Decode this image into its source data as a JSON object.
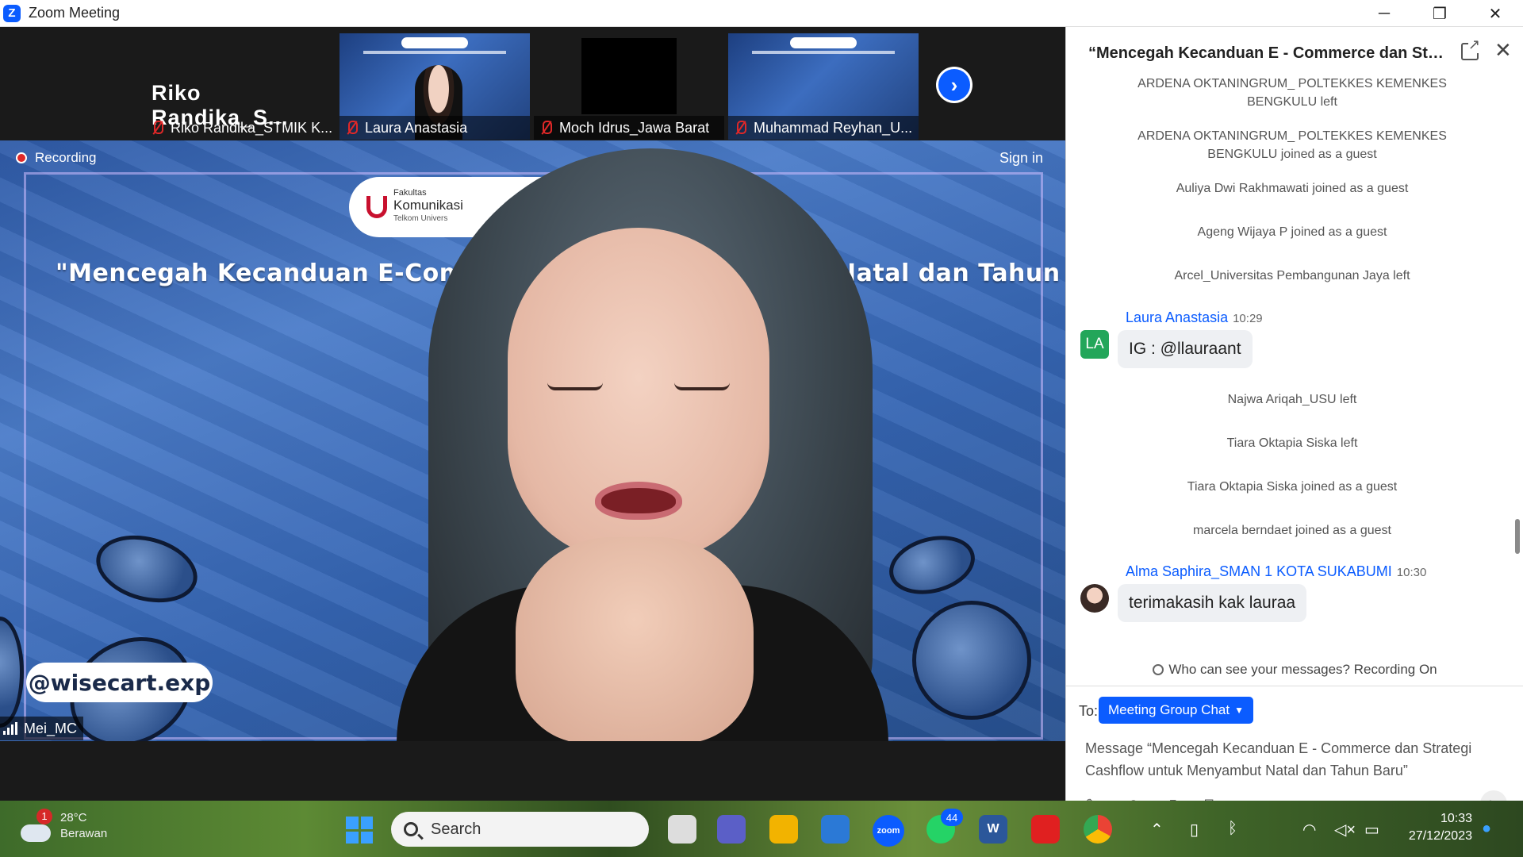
{
  "window": {
    "title": "Zoom Meeting",
    "minimize_glyph": "─",
    "restore_glyph": "❐",
    "close_glyph": "✕"
  },
  "strip": {
    "featured_name": "Riko Randika_S...",
    "participants": [
      {
        "name": "Riko Randika_STMIK K...",
        "muted": true
      },
      {
        "name": "Laura Anastasia",
        "muted": true
      },
      {
        "name": "Moch Idrus_Jawa Barat",
        "muted": true
      },
      {
        "name": "Muhammad Reyhan_U...",
        "muted": true
      }
    ],
    "next_glyph": "›"
  },
  "main_video": {
    "recording_label": "Recording",
    "sign_in_label": "Sign in",
    "logo_small": "Fakultas",
    "logo_main": "Komunikasi",
    "logo_sub": "Telkom Univers",
    "headline_left": "\"Mencegah Kecanduan E-Commerce dan",
    "headline_right": "nyambut Natal dan Tahun Baru\"",
    "handle": "@wisecart.exp",
    "speaker_name": "Mei_MC"
  },
  "chat": {
    "header": "“Mencegah Kecanduan E - Commerce dan Str...",
    "close_glyph": "✕",
    "system_messages": [
      "ARDENA OKTANINGRUM_ POLTEKKES KEMENKES BENGKULU left",
      "ARDENA OKTANINGRUM_ POLTEKKES KEMENKES BENGKULU joined as a guest",
      "Auliya Dwi Rakhmawati joined as a guest",
      "Ageng Wijaya P joined as a guest",
      "Arcel_Universitas Pembangunan Jaya left",
      "Najwa Ariqah_USU left",
      "Tiara Oktapia Siska left",
      "Tiara Oktapia Siska joined as a guest",
      "marcela berndaet joined as a guest"
    ],
    "messages": [
      {
        "sender": "Laura Anastasia",
        "time": "10:29",
        "initials": "LA",
        "text": "IG : @llauraant"
      },
      {
        "sender": "Alma Saphira_SMAN 1 KOTA SUKABUMI",
        "time": "10:30",
        "initials": "",
        "text": "terimakasih kak lauraa"
      }
    ],
    "privacy_note": "Who can see your messages? Recording On",
    "to_label": "To:",
    "recipient": "Meeting Group Chat",
    "input_placeholder": "Message “Mencegah Kecanduan E - Commerce dan Strategi Cashflow untuk Menyambut Natal dan Tahun Baru”",
    "accent": "#0b5cff"
  },
  "taskbar": {
    "weather_badge": "1",
    "temperature": "28°C",
    "location": "Berawan",
    "search_label": "Search",
    "zoom_label": "zoom",
    "whatsapp_badge": "44",
    "time": "10:33",
    "date": "27/12/2023"
  }
}
